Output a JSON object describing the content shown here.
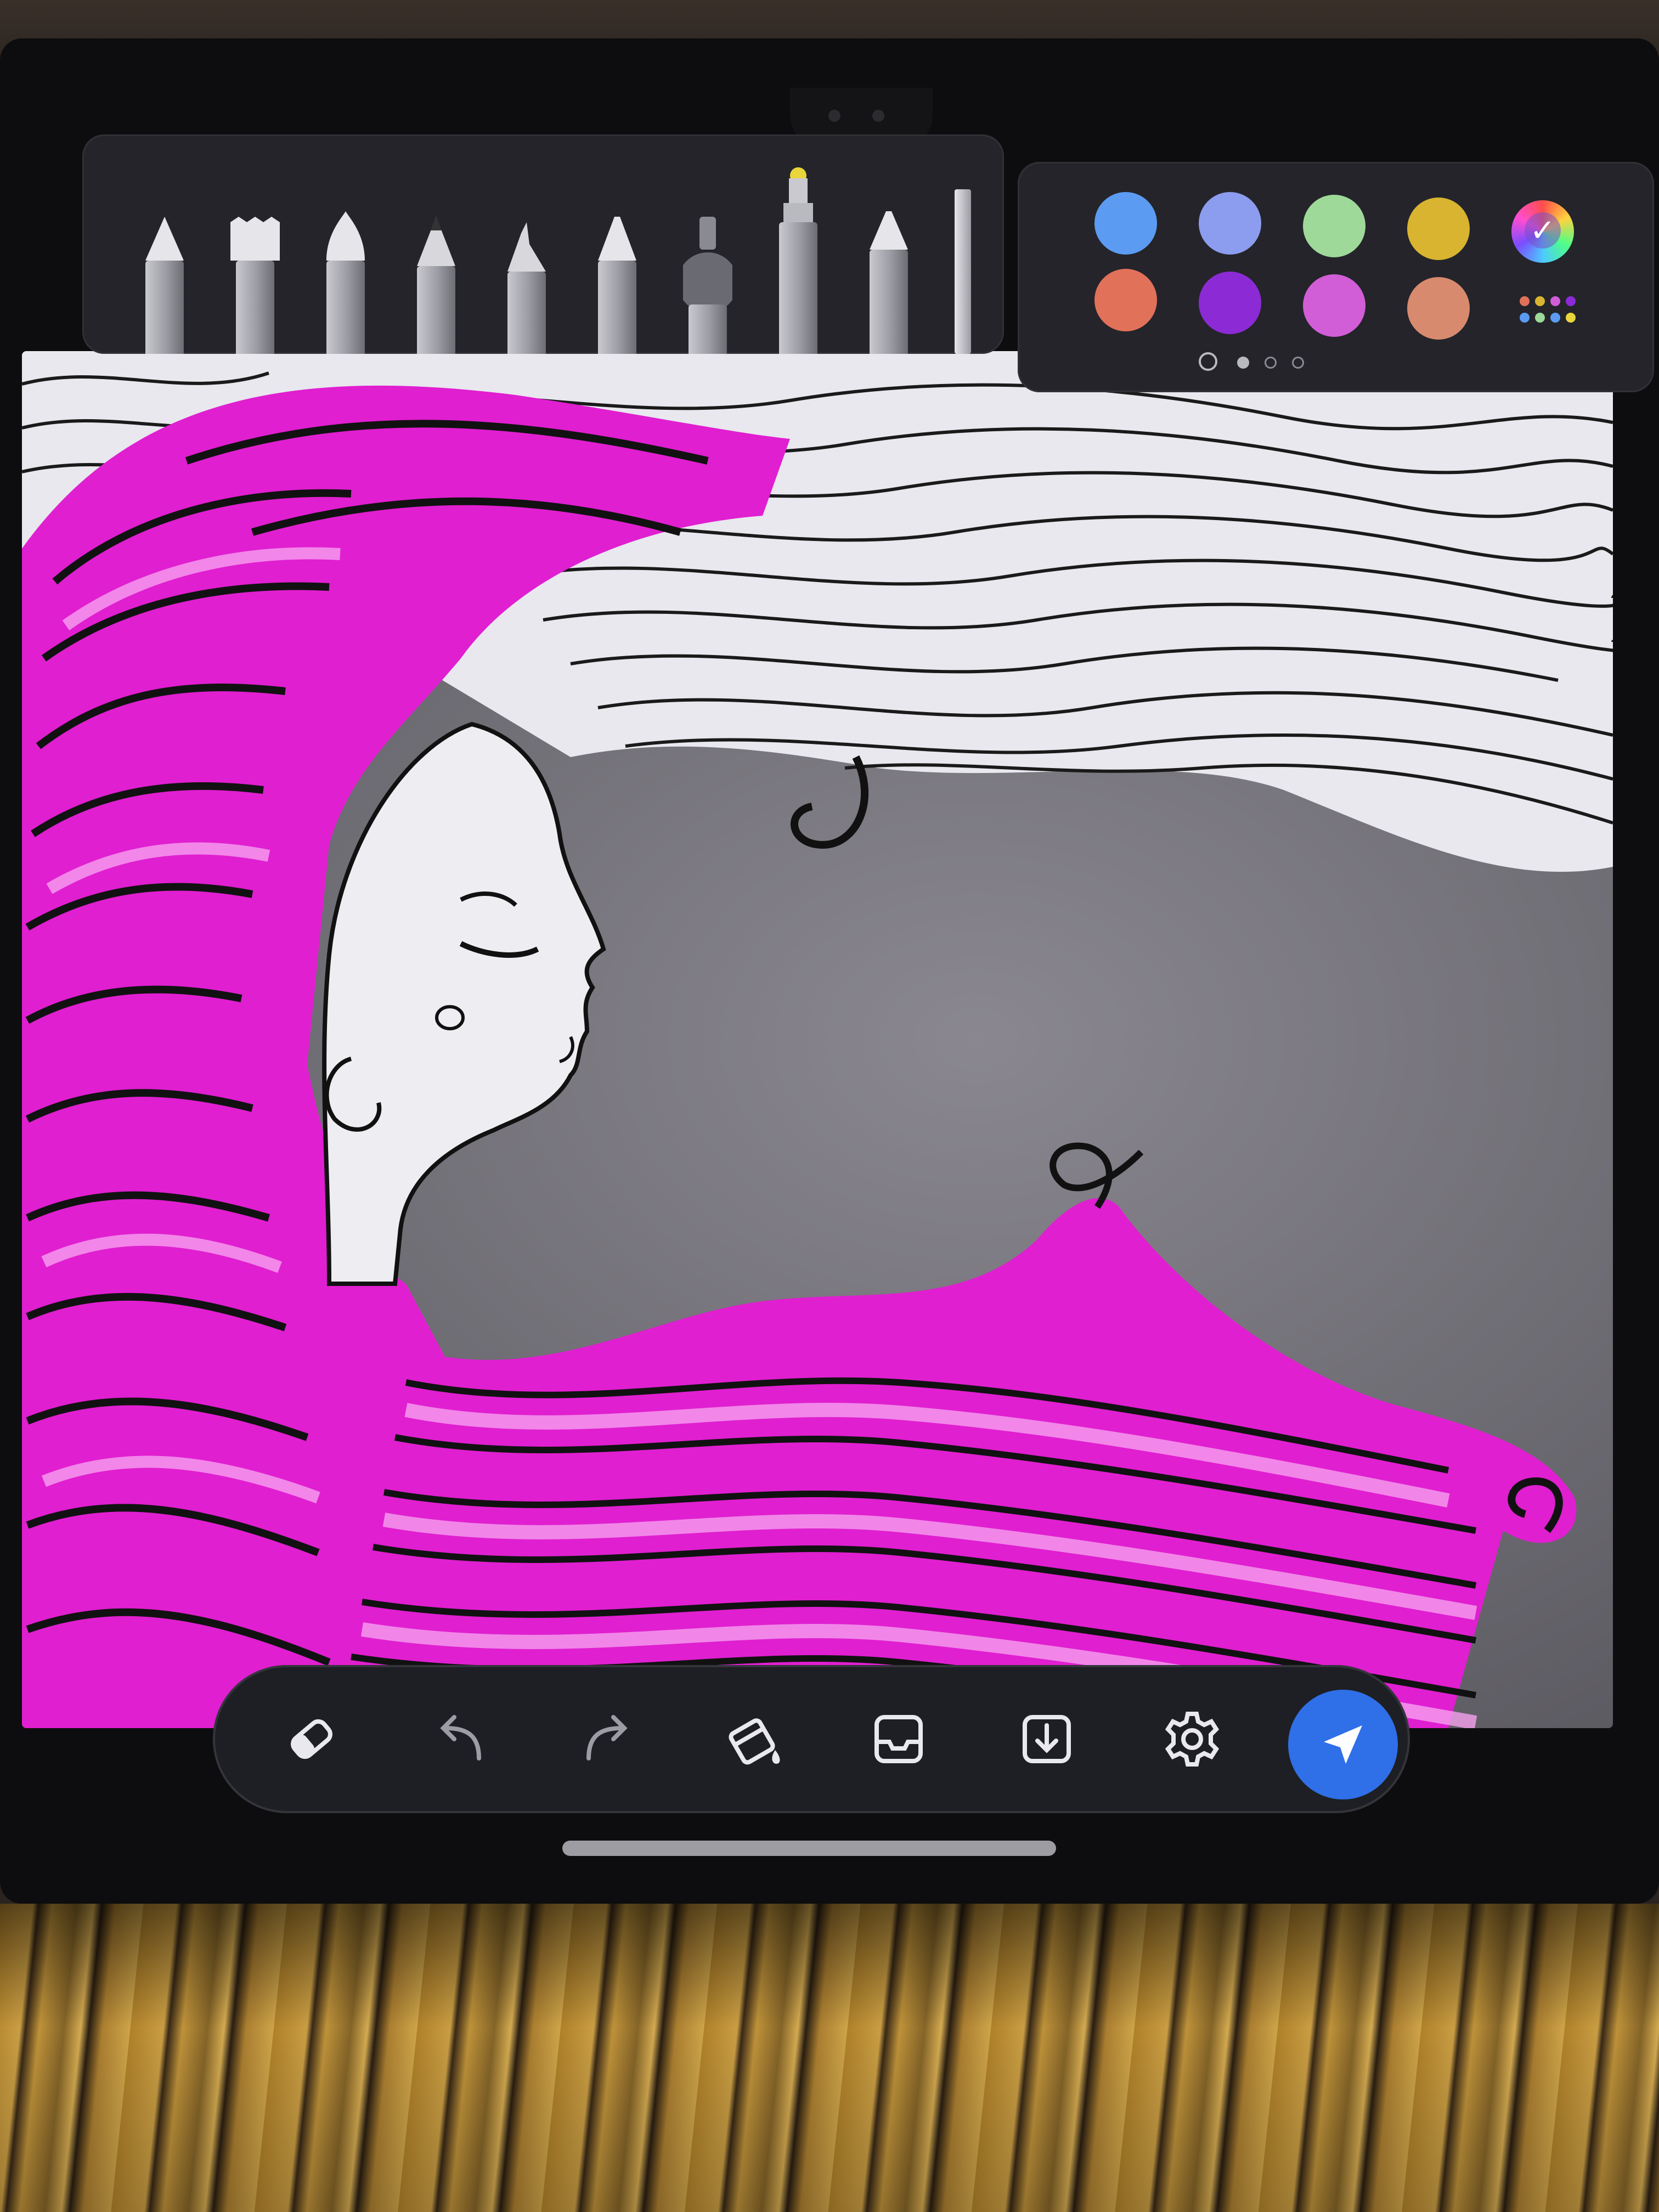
{
  "app": {
    "name": "drawing-app"
  },
  "brush_tray": {
    "brushes": [
      {
        "name": "pen",
        "icon": "pen-brush-icon"
      },
      {
        "name": "flat-brush",
        "icon": "flat-brush-icon"
      },
      {
        "name": "soft-tip-brush",
        "icon": "soft-tip-brush-icon"
      },
      {
        "name": "pencil",
        "icon": "pencil-brush-icon"
      },
      {
        "name": "calligraphy-pen",
        "icon": "calligraphy-brush-icon"
      },
      {
        "name": "fine-liner",
        "icon": "fine-liner-brush-icon"
      },
      {
        "name": "airbrush",
        "icon": "airbrush-brush-icon"
      },
      {
        "name": "highlighter",
        "icon": "highlighter-brush-icon",
        "selected": true,
        "tip_color": "#e8d63a"
      },
      {
        "name": "crayon",
        "icon": "crayon-brush-icon"
      },
      {
        "name": "ruler",
        "icon": "ruler-brush-icon"
      }
    ]
  },
  "palette": {
    "swatches": [
      {
        "name": "blue",
        "color": "#5b9cf2"
      },
      {
        "name": "periwinkle",
        "color": "#8c9cee"
      },
      {
        "name": "mint",
        "color": "#9ed99a"
      },
      {
        "name": "mustard",
        "color": "#d8b430"
      },
      {
        "name": "coral",
        "color": "#e2715a"
      },
      {
        "name": "violet",
        "color": "#8c2bd6"
      },
      {
        "name": "orchid",
        "color": "#d15ed6"
      },
      {
        "name": "salmon",
        "color": "#d88a6e"
      }
    ],
    "picker_icon": "color-picker-icon",
    "more_icon": "more-colors-icon",
    "pages": {
      "current": 1,
      "total": 3
    }
  },
  "toolbar": {
    "tools": [
      {
        "name": "eraser",
        "icon": "eraser-icon"
      },
      {
        "name": "undo",
        "icon": "undo-icon"
      },
      {
        "name": "redo",
        "icon": "redo-icon"
      },
      {
        "name": "fill",
        "icon": "paint-bucket-icon"
      },
      {
        "name": "tray",
        "icon": "inbox-tray-icon"
      },
      {
        "name": "save",
        "icon": "download-icon"
      },
      {
        "name": "settings",
        "icon": "gear-icon"
      }
    ],
    "send_icon": "send-icon",
    "send_color": "#2f6fe8"
  },
  "colors": {
    "hair_magenta": "#e01fd0",
    "hair_pink": "#f26ee8",
    "hair_white": "#e8e8ee",
    "line": "#111111"
  }
}
